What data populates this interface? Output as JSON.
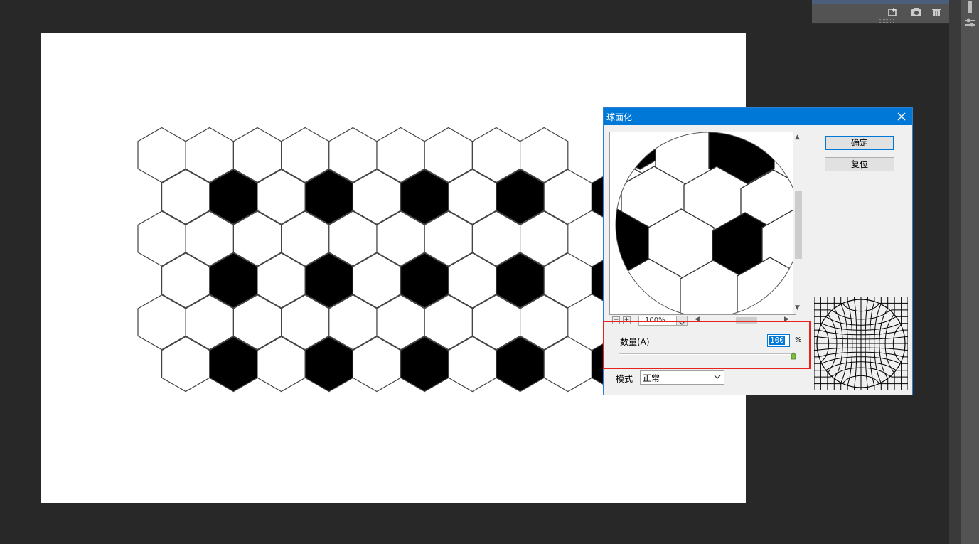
{
  "dialog": {
    "title": "球面化",
    "ok_label": "确定",
    "reset_label": "复位",
    "zoom_value": "100%",
    "amount_label": "数量(A)",
    "amount_value": "100",
    "amount_unit": "%",
    "amount_fraction": 1.0,
    "mode_label": "模式",
    "mode_value": "正常"
  },
  "colors": {
    "accent": "#0078d7",
    "highlight": "#e8231e",
    "workspace": "#282828"
  },
  "icons": {
    "close": "close-icon",
    "new_layer": "new-layer-icon",
    "camera": "camera-icon",
    "trash": "trash-icon",
    "dropdown": "chevron-down-icon"
  }
}
